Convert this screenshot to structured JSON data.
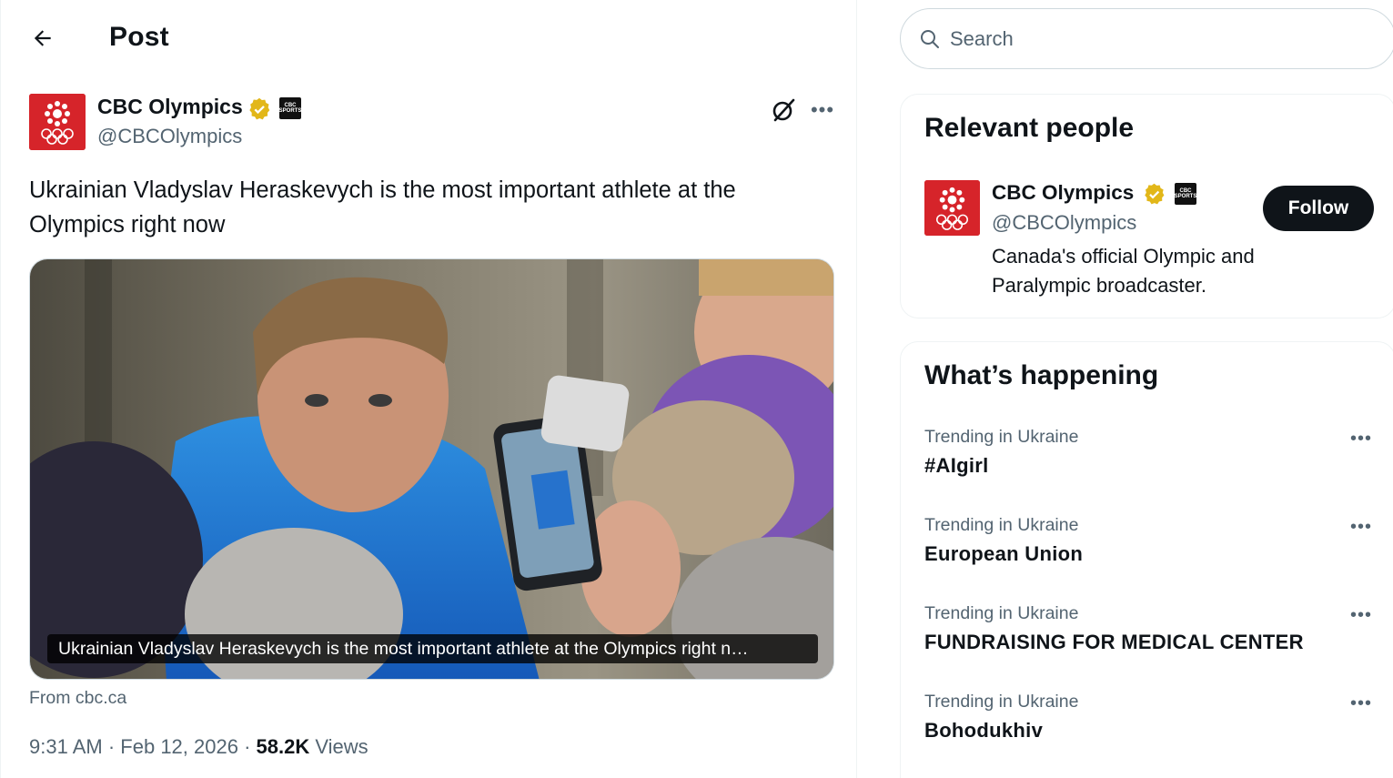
{
  "header": {
    "title": "Post",
    "back_icon": "arrow-left-icon"
  },
  "post": {
    "author": {
      "name": "CBC Olympics",
      "handle": "@CBCOlympics",
      "verified_color": "#e2b719",
      "affiliate_badge": "CBC SPORTS"
    },
    "text": "Ukrainian Vladyslav Heraskevych is the most important athlete at the Olympics right now",
    "card": {
      "caption": "Ukrainian Vladyslav Heraskevych is the most important athlete at the Olympics right n…",
      "source": "From cbc.ca"
    },
    "time": "9:31 AM",
    "date": "Feb 12, 2026",
    "views_count": "58.2K",
    "views_label": "Views",
    "separator": "·"
  },
  "search": {
    "placeholder": "Search"
  },
  "relevant_people": {
    "title": "Relevant people",
    "person": {
      "name": "CBC Olympics",
      "handle": "@CBCOlympics",
      "bio": "Canada's official Olympic and Paralympic broadcaster.",
      "follow_label": "Follow",
      "affiliate_badge": "CBC SPORTS"
    }
  },
  "whats_happening": {
    "title": "What’s happening",
    "trends": [
      {
        "context": "Trending in Ukraine",
        "name": "#AIgirl"
      },
      {
        "context": "Trending in Ukraine",
        "name": "European Union"
      },
      {
        "context": "Trending in Ukraine",
        "name": "FUNDRAISING FOR MEDICAL CENTER"
      },
      {
        "context": "Trending in Ukraine",
        "name": "Bohodukhiv"
      }
    ]
  },
  "colors": {
    "brand_red": "#d6242a",
    "text_primary": "#0f1419",
    "text_secondary": "#536471",
    "border": "#cfd9de"
  }
}
